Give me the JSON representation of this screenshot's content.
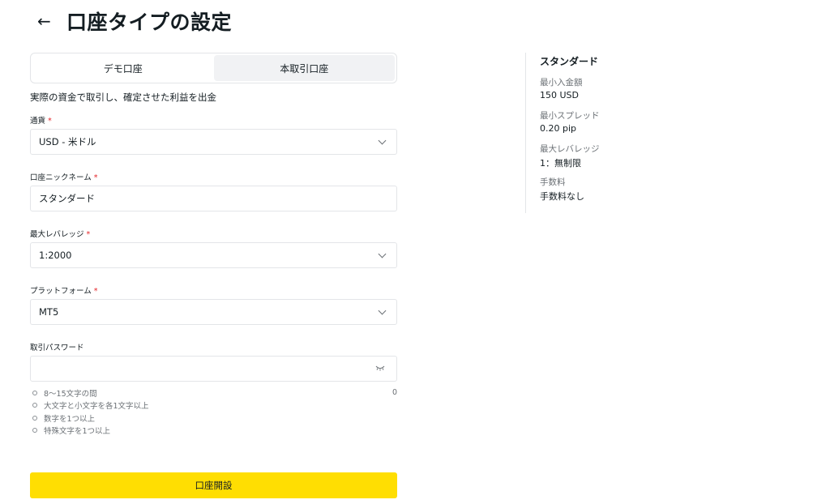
{
  "header": {
    "back_icon": "←",
    "title": "口座タイプの設定"
  },
  "tabs": [
    {
      "label": "デモ口座",
      "active": false
    },
    {
      "label": "本取引口座",
      "active": true
    }
  ],
  "description": "実際の資金で取引し、確定させた利益を出金",
  "required_mark": "*",
  "fields": {
    "currency": {
      "label": "通貨",
      "value": "USD - 米ドル"
    },
    "nickname": {
      "label": "口座ニックネーム",
      "value": "スタンダード"
    },
    "leverage": {
      "label": "最大レバレッジ",
      "value": "1:2000"
    },
    "platform": {
      "label": "プラットフォーム",
      "value": "MT5"
    },
    "password": {
      "label": "取引パスワード",
      "value": "",
      "toggle_icon": "eye-closed",
      "char_count": "0"
    }
  },
  "password_requirements": [
    "8～15文字の間",
    "大文字と小文字を各1文字以上",
    "数字を1つ以上",
    "特殊文字を1つ以上"
  ],
  "submit_label": "口座開設",
  "summary": {
    "title": "スタンダード",
    "items": [
      {
        "label": "最小入金額",
        "value": "150 USD"
      },
      {
        "label": "最小スプレッド",
        "value": "0.20 pip"
      },
      {
        "label": "最大レバレッジ",
        "value": "1：無制限"
      },
      {
        "label": "手数料",
        "value": "手数料なし"
      }
    ]
  },
  "colors": {
    "accent": "#ffde02",
    "required": "#e5262a",
    "border": "#e3e5e8",
    "muted": "#6b7075"
  }
}
